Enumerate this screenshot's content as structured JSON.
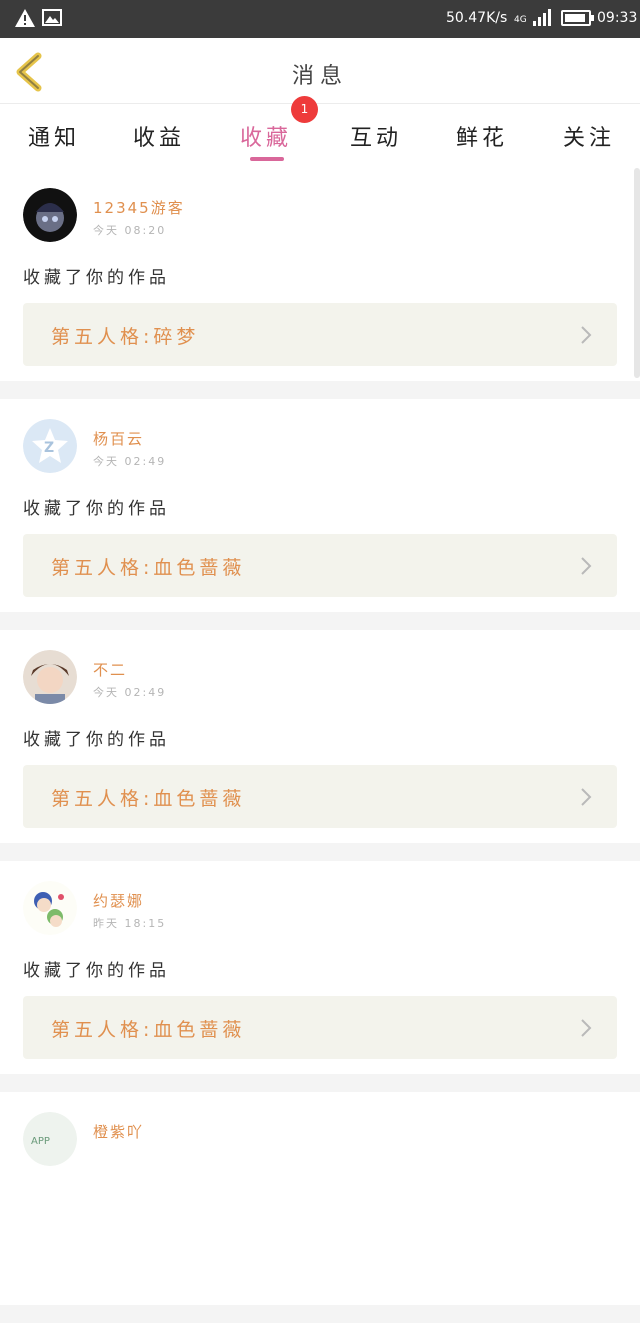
{
  "status_bar": {
    "speed": "50.47K/s",
    "network": "4G",
    "time": "09:33"
  },
  "header": {
    "title": "消息"
  },
  "tabs": [
    {
      "label": "通知"
    },
    {
      "label": "收益"
    },
    {
      "label": "收藏",
      "active": true,
      "badge": "1"
    },
    {
      "label": "互动"
    },
    {
      "label": "鲜花"
    },
    {
      "label": "关注"
    }
  ],
  "items": [
    {
      "user": "12345游客",
      "time": "今天 08:20",
      "action": "收藏了你的作品",
      "work": "第五人格:碎梦"
    },
    {
      "user": "杨百云",
      "time": "今天 02:49",
      "action": "收藏了你的作品",
      "work": "第五人格:血色蔷薇"
    },
    {
      "user": "不二",
      "time": "今天 02:49",
      "action": "收藏了你的作品",
      "work": "第五人格:血色蔷薇"
    },
    {
      "user": "约瑟娜",
      "time": "昨天 18:15",
      "action": "收藏了你的作品",
      "work": "第五人格:血色蔷薇"
    },
    {
      "user": "橙紫吖",
      "time": "",
      "action": "",
      "work": ""
    }
  ],
  "colors": {
    "accent": "#d9679a",
    "username": "#e0904f",
    "badge": "#ee3b3b"
  }
}
